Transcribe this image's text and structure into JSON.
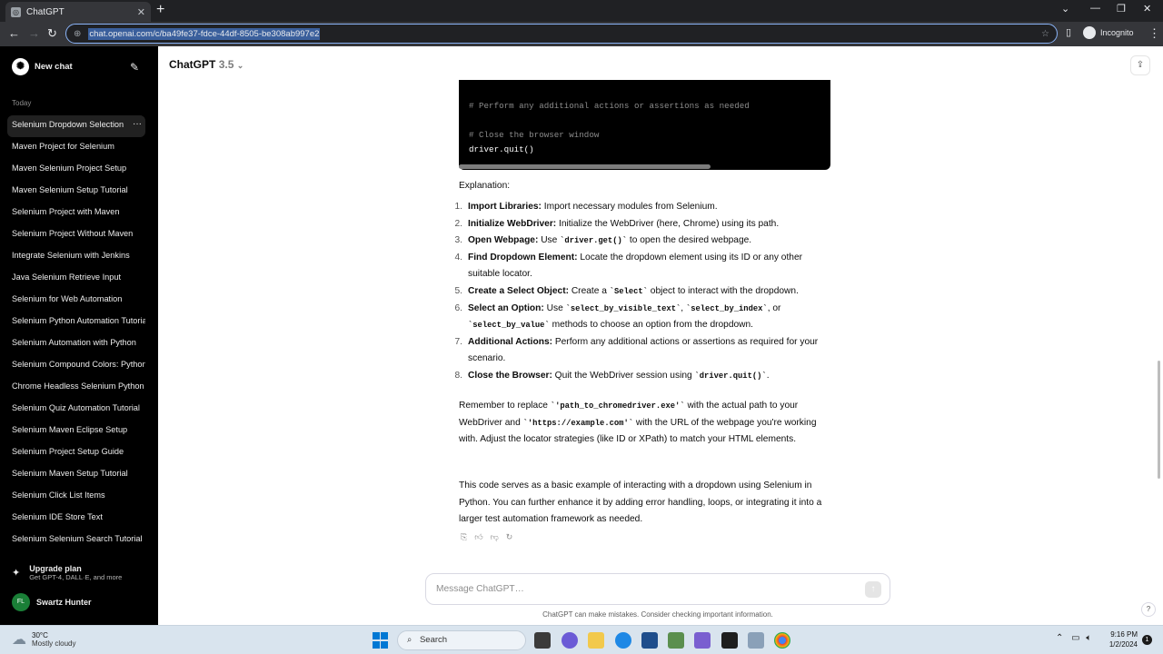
{
  "browser": {
    "tab_title": "ChatGPT",
    "tab_close": "✕",
    "new_tab": "+",
    "url": "chat.openai.com/c/ba49fe37-fdce-44df-8505-be308ab997e2",
    "profile_label": "Incognito"
  },
  "sidebar": {
    "new_chat_label": "New chat",
    "section_today": "Today",
    "history": [
      "Selenium Dropdown Selection",
      "Maven Project for Selenium",
      "Maven Selenium Project Setup",
      "Maven Selenium Setup Tutorial",
      "Selenium Project with Maven",
      "Selenium Project Without Maven",
      "Integrate Selenium with Jenkins",
      "Java Selenium Retrieve Input",
      "Selenium for Web Automation",
      "Selenium Python Automation Tutorial",
      "Selenium Automation with Python",
      "Selenium Compound Colors: Python",
      "Chrome Headless Selenium Python",
      "Selenium Quiz Automation Tutorial",
      "Selenium Maven Eclipse Setup",
      "Selenium Project Setup Guide",
      "Selenium Maven Setup Tutorial",
      "Selenium Click List Items",
      "Selenium IDE Store Text",
      "Selenium Selenium Search Tutorial"
    ],
    "more_label": "···",
    "upgrade_title": "Upgrade plan",
    "upgrade_sub": "Get GPT-4, DALL·E, and more",
    "user_initials": "FL",
    "user_name": "Swartz Hunter"
  },
  "header": {
    "model_name": "ChatGPT",
    "model_version": "3.5"
  },
  "code": {
    "line1": "# Perform any additional actions or assertions as needed",
    "line2": "# Close the browser window",
    "line3": "driver.quit()"
  },
  "message": {
    "explanation_label": "Explanation:",
    "steps": [
      {
        "num": "1.",
        "title": "Import Libraries:",
        "text": " Import necessary modules from Selenium."
      },
      {
        "num": "2.",
        "title": "Initialize WebDriver:",
        "text": " Initialize the WebDriver (here, Chrome) using its path."
      },
      {
        "num": "3.",
        "title": "Open Webpage:",
        "pre": " Use ",
        "code": "`driver.get()`",
        "text": " to open the desired webpage."
      },
      {
        "num": "4.",
        "title": "Find Dropdown Element:",
        "text": " Locate the dropdown element using its ID or any other suitable locator."
      },
      {
        "num": "5.",
        "title": "Create a Select Object:",
        "pre": " Create a ",
        "code": "`Select`",
        "text": " object to interact with the dropdown."
      },
      {
        "num": "6.",
        "title": "Select an Option:",
        "pre": " Use ",
        "code": "`select_by_visible_text`",
        "mid": ", ",
        "code2": "`select_by_index`",
        "mid2": ", or ",
        "code3": "`select_by_value`",
        "text": " methods to choose an option from the dropdown."
      },
      {
        "num": "7.",
        "title": "Additional Actions:",
        "text": " Perform any additional actions or assertions as required for your scenario."
      },
      {
        "num": "8.",
        "title": "Close the Browser:",
        "pre": " Quit the WebDriver session using ",
        "code": "`driver.quit()`",
        "text": "."
      }
    ],
    "para1_a": "Remember to replace ",
    "para1_code1": "`'path_to_chromedriver.exe'`",
    "para1_b": " with the actual path to your WebDriver and ",
    "para1_code2": "`'https://example.com'`",
    "para1_c": " with the URL of the webpage you're working with. Adjust the locator strategies (like ID or XPath) to match your HTML elements.",
    "para2": "This code serves as a basic example of interacting with a dropdown using Selenium in Python. You can further enhance it by adding error handling, loops, or integrating it into a larger test automation framework as needed."
  },
  "composer": {
    "placeholder": "Message ChatGPT…",
    "disclaimer": "ChatGPT can make mistakes. Consider checking important information.",
    "help": "?"
  },
  "taskbar": {
    "temp": "30°C",
    "weather": "Mostly cloudy",
    "search_label": "Search",
    "time": "9:16 PM",
    "date": "1/2/2024",
    "notif_count": "1"
  }
}
